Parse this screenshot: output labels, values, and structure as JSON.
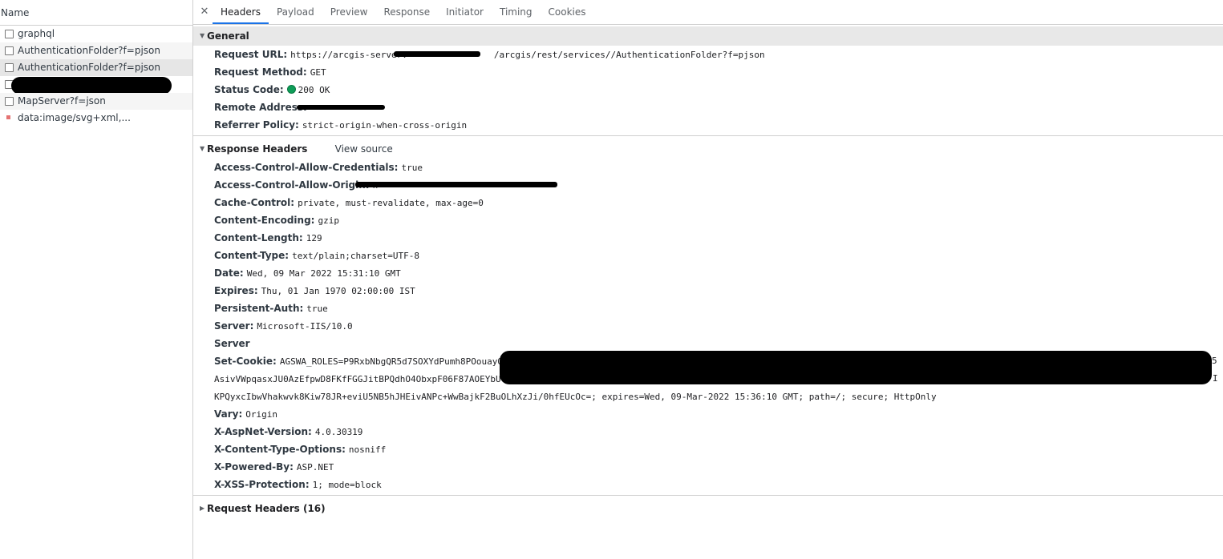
{
  "left_panel": {
    "column_header": "Name",
    "requests": [
      {
        "name": "graphql",
        "type": "checkbox"
      },
      {
        "name": "AuthenticationFolder?f=pjson",
        "type": "checkbox"
      },
      {
        "name": "AuthenticationFolder?f=pjson",
        "type": "checkbox",
        "selected": true
      },
      {
        "name": "",
        "type": "checkbox",
        "redacted": true
      },
      {
        "name": "MapServer?f=json",
        "type": "checkbox"
      },
      {
        "name": "data:image/svg+xml,...",
        "type": "image"
      }
    ]
  },
  "tabs": {
    "close_icon": "✕",
    "items": [
      "Headers",
      "Payload",
      "Preview",
      "Response",
      "Initiator",
      "Timing",
      "Cookies"
    ],
    "active": "Headers"
  },
  "general": {
    "title": "General",
    "rows": [
      {
        "key": "Request URL:",
        "value_prefix": "https://arcgis-server.",
        "value_suffix": "/arcgis/rest/services//AuthenticationFolder?f=pjson"
      },
      {
        "key": "Request Method:",
        "value": "GET"
      },
      {
        "key": "Status Code:",
        "value": "200 OK",
        "status_color": "#0f9d58"
      },
      {
        "key": "Remote Address:",
        "value": ""
      },
      {
        "key": "Referrer Policy:",
        "value": "strict-origin-when-cross-origin"
      }
    ]
  },
  "response_headers": {
    "title": "Response Headers",
    "view_source": "View source",
    "rows": [
      {
        "key": "Access-Control-Allow-Credentials:",
        "value": "true"
      },
      {
        "key": "Access-Control-Allow-Origin:",
        "value": "h"
      },
      {
        "key": "Cache-Control:",
        "value": "private, must-revalidate, max-age=0"
      },
      {
        "key": "Content-Encoding:",
        "value": "gzip"
      },
      {
        "key": "Content-Length:",
        "value": "129"
      },
      {
        "key": "Content-Type:",
        "value": "text/plain;charset=UTF-8"
      },
      {
        "key": "Date:",
        "value": "Wed, 09 Mar 2022 15:31:10 GMT"
      },
      {
        "key": "Expires:",
        "value": "Thu, 01 Jan 1970 02:00:00 IST"
      },
      {
        "key": "Persistent-Auth:",
        "value": "true"
      },
      {
        "key": "Server:",
        "value": "Microsoft-IIS/10.0"
      },
      {
        "key": "Server",
        "value": ""
      }
    ],
    "set_cookie": {
      "key": "Set-Cookie:",
      "line1": "AGSWA_ROLES=P9RxbNbgQR5d7SOXYdPumh8POouayQO",
      "line1_end": "5",
      "line2": "AsivVWpqasxJU0AzEfpwD8FKfFGGJitBPQdhO4ObxpF06F87AOEYbU",
      "line2_end": "I",
      "line3": "KPQyxcIbwVhakwvk8Kiw78JR+eviU5NB5hJHEivANPc+WwBajkF2BuOLhXzJi/0hfEUcOc=; expires=Wed, 09-Mar-2022 15:36:10 GMT; path=/; secure; HttpOnly"
    },
    "rows_after": [
      {
        "key": "Vary:",
        "value": "Origin"
      },
      {
        "key": "X-AspNet-Version:",
        "value": "4.0.30319"
      },
      {
        "key": "X-Content-Type-Options:",
        "value": "nosniff"
      },
      {
        "key": "X-Powered-By:",
        "value": "ASP.NET"
      },
      {
        "key": "X-XSS-Protection:",
        "value": "1; mode=block"
      }
    ]
  },
  "request_headers": {
    "title": "Request Headers (16)"
  }
}
